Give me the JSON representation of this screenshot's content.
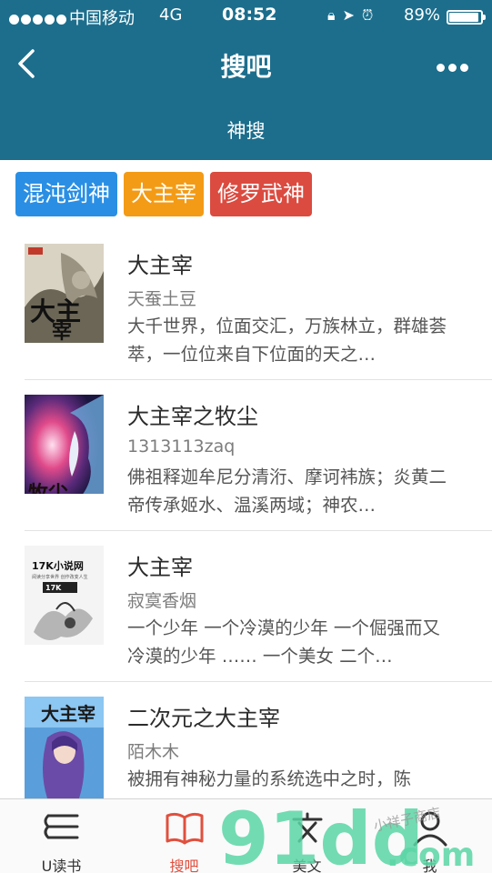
{
  "status_bar": {
    "carrier": "中国移动",
    "network": "4G",
    "time": "08:52",
    "battery": "89%",
    "battery_level": 0.89
  },
  "header": {
    "title": "搜吧",
    "subtitle": "神搜"
  },
  "tags": [
    {
      "label": "混沌剑神",
      "color": "#2a8fe4"
    },
    {
      "label": "大主宰",
      "color": "#f39b16"
    },
    {
      "label": "修罗武神",
      "color": "#db4b40"
    }
  ],
  "books": [
    {
      "title": "大主宰",
      "author": "天蚕土豆",
      "description": "大千世界，位面交汇，万族林立，群雄荟萃，一位位来自下位面的天之…",
      "cover_text": "大主宰"
    },
    {
      "title": "大主宰之牧尘",
      "author": "1313113zaq",
      "description": "佛祖释迦牟尼分清洐、摩诃袆族；炎黄二帝传承姬水、温溪两域；神农…",
      "cover_text": ""
    },
    {
      "title": "大主宰",
      "author": "寂寞香烟",
      "description": "一个少年 一个冷漠的少年 一个倔强而又冷漠的少年 …… 一个美女 二个…",
      "cover_text": "17K小说网",
      "cover_subtext": "阅读分享世界 创作改变人生"
    },
    {
      "title": "二次元之大主宰",
      "author": "陌木木",
      "description": "被拥有神秘力量的系统选中之时，陈",
      "cover_text": "大主宰"
    }
  ],
  "tabbar": [
    {
      "label": "U读书",
      "icon": "book-stack-icon",
      "active": false
    },
    {
      "label": "搜吧",
      "icon": "open-book-icon",
      "active": true
    },
    {
      "label": "美文",
      "icon": "text-icon",
      "active": false
    },
    {
      "label": "我",
      "icon": "person-icon",
      "active": false
    }
  ],
  "watermark": {
    "logo": "91dd",
    "domain": ".com",
    "slogan": "小祥子商店"
  }
}
